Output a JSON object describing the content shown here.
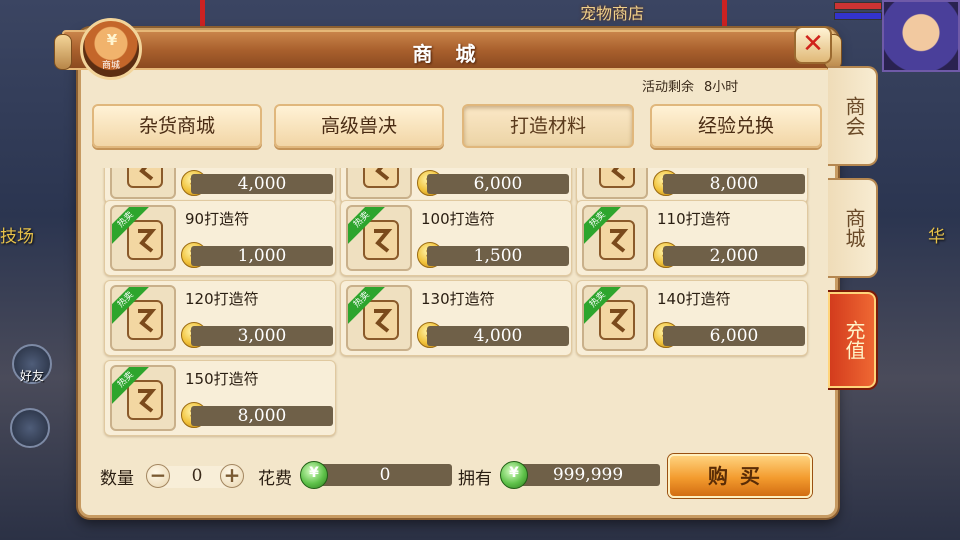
{
  "background": {
    "sign": "宠物商店",
    "left_text_1": "技场",
    "left_text_2": "好友",
    "right_text": "华"
  },
  "header": {
    "title": "商 城",
    "emblem_label": "商城",
    "close_icon": "close-x-icon",
    "timer_label": "活动剩余",
    "timer_value": "8小时"
  },
  "tabs": [
    {
      "label": "杂货商城",
      "active": false
    },
    {
      "label": "高级兽决",
      "active": false
    },
    {
      "label": "打造材料",
      "active": true
    },
    {
      "label": "经验兑换",
      "active": false
    }
  ],
  "items_partial": [
    {
      "price": "4,000"
    },
    {
      "price": "6,000"
    },
    {
      "price": "8,000"
    }
  ],
  "items": [
    {
      "name": "90打造符",
      "price": "1,000",
      "badge": "热卖"
    },
    {
      "name": "100打造符",
      "price": "1,500",
      "badge": "热卖"
    },
    {
      "name": "110打造符",
      "price": "2,000",
      "badge": "热卖"
    },
    {
      "name": "120打造符",
      "price": "3,000",
      "badge": "热卖"
    },
    {
      "name": "130打造符",
      "price": "4,000",
      "badge": "热卖"
    },
    {
      "name": "140打造符",
      "price": "6,000",
      "badge": "热卖"
    },
    {
      "name": "150打造符",
      "price": "8,000",
      "badge": "热卖"
    }
  ],
  "footer": {
    "quantity_label": "数量",
    "quantity_value": "0",
    "minus_label": "−",
    "plus_label": "+",
    "cost_label": "花费",
    "cost_value": "0",
    "owned_label": "拥有",
    "owned_value": "999,999",
    "buy_label": "购买"
  },
  "side_tabs": [
    {
      "label": "商会"
    },
    {
      "label": "商城"
    },
    {
      "label": "充值"
    }
  ],
  "colors": {
    "hot_badge": "#2da52d",
    "buy_button": "#f39b2e",
    "recharge_tab": "#d23a1c"
  }
}
